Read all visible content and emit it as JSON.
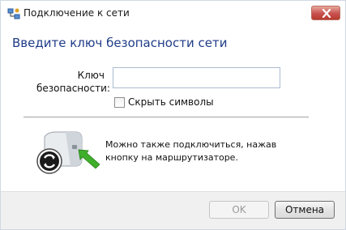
{
  "window": {
    "title": "Подключение к сети",
    "title_icon": "network-icon",
    "close_icon": "close-icon"
  },
  "main": {
    "heading": "Введите ключ безопасности сети",
    "key_label": "Ключ безопасности:",
    "key_value": "",
    "hide_chars_label": "Скрыть символы",
    "hide_chars_checked": false,
    "router_icon": "router-wps-icon",
    "hint": "Можно также подключиться, нажав кнопку на маршрутизаторе."
  },
  "footer": {
    "ok_label": "OK",
    "cancel_label": "Отмена"
  }
}
